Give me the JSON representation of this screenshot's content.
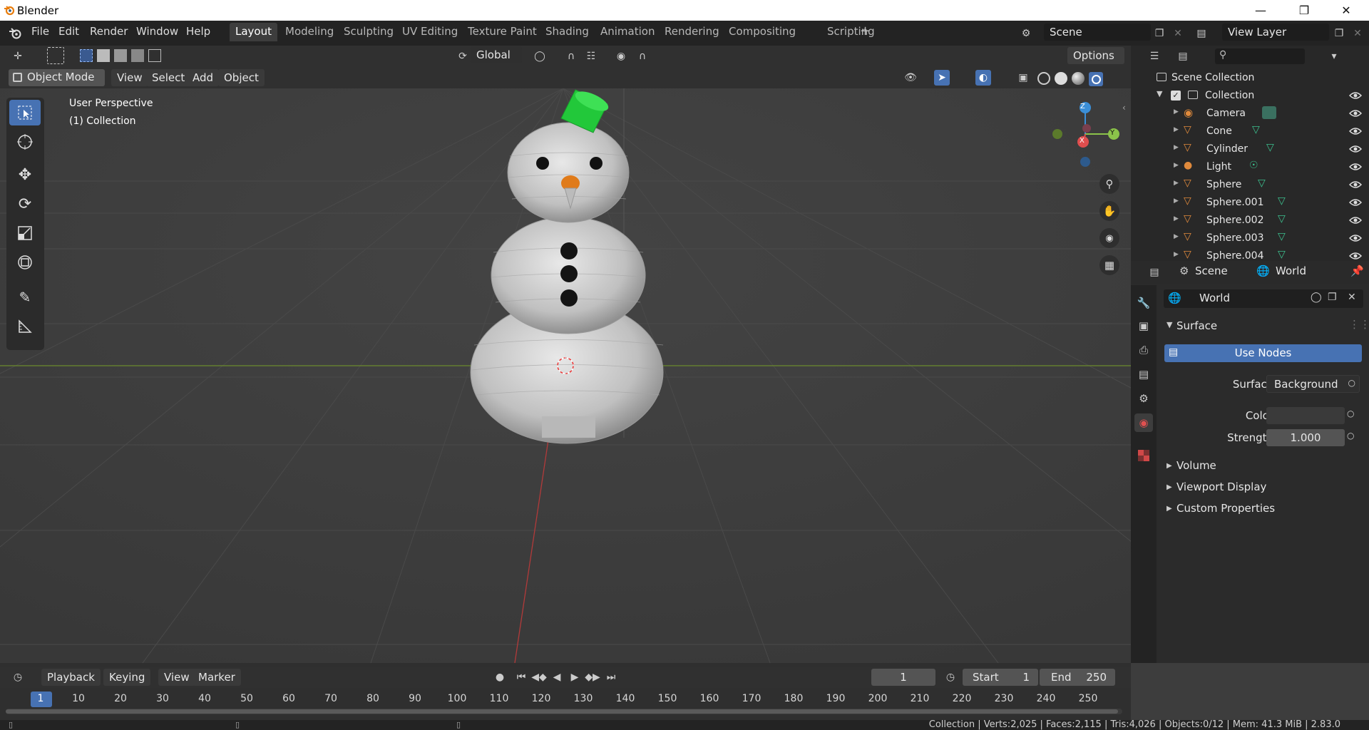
{
  "window": {
    "title": "Blender"
  },
  "menu": {
    "items": [
      "File",
      "Edit",
      "Render",
      "Window",
      "Help"
    ]
  },
  "workspaces": [
    "Layout",
    "Modeling",
    "Sculpting",
    "UV Editing",
    "Texture Paint",
    "Shading",
    "Animation",
    "Rendering",
    "Compositing",
    "Scripting"
  ],
  "active_workspace": "Layout",
  "add_workspace": "+",
  "scene": {
    "name": "Scene",
    "view_layer": "View Layer"
  },
  "viewport_header": {
    "transform_orientation": "Global",
    "options": "Options",
    "mode": "Object Mode",
    "menus": [
      "View",
      "Select",
      "Add",
      "Object"
    ]
  },
  "viewport": {
    "perspective_label": "User Perspective",
    "collection_label": "(1) Collection",
    "gizmo": {
      "z": "Z",
      "y": "Y",
      "x": "X"
    }
  },
  "outliner": {
    "root": "Scene Collection",
    "collection": "Collection",
    "items": [
      "Camera",
      "Cone",
      "Cylinder",
      "Light",
      "Sphere",
      "Sphere.001",
      "Sphere.002",
      "Sphere.003",
      "Sphere.004"
    ]
  },
  "properties": {
    "tab_scene": "Scene",
    "tab_world": "World",
    "world_name": "World",
    "surface_panel": "Surface",
    "use_nodes": "Use Nodes",
    "surface_label": "Surface",
    "surface_value": "Background",
    "color_label": "Color",
    "strength_label": "Strength",
    "strength_value": "1.000",
    "panels": [
      "Volume",
      "Viewport Display",
      "Custom Properties"
    ]
  },
  "timeline": {
    "menus": [
      "Playback",
      "Keying",
      "View",
      "Marker"
    ],
    "current_frame": "1",
    "start_label": "Start",
    "start_value": "1",
    "end_label": "End",
    "end_value": "250",
    "ticks": [
      "1",
      "10",
      "20",
      "30",
      "40",
      "50",
      "60",
      "70",
      "80",
      "90",
      "100",
      "110",
      "120",
      "130",
      "140",
      "150",
      "160",
      "170",
      "180",
      "190",
      "200",
      "210",
      "220",
      "230",
      "240",
      "250"
    ]
  },
  "status": {
    "text": "Collection | Verts:2,025 | Faces:2,115 | Tris:4,026 | Objects:0/12 | Mem: 41.3 MiB | 2.83.0"
  },
  "colors": {
    "accent": "#4772b3",
    "orange_icon": "#e08a3c",
    "green_icon": "#3cc08e",
    "hat": "#22c83a",
    "nose": "#e07b1a"
  }
}
